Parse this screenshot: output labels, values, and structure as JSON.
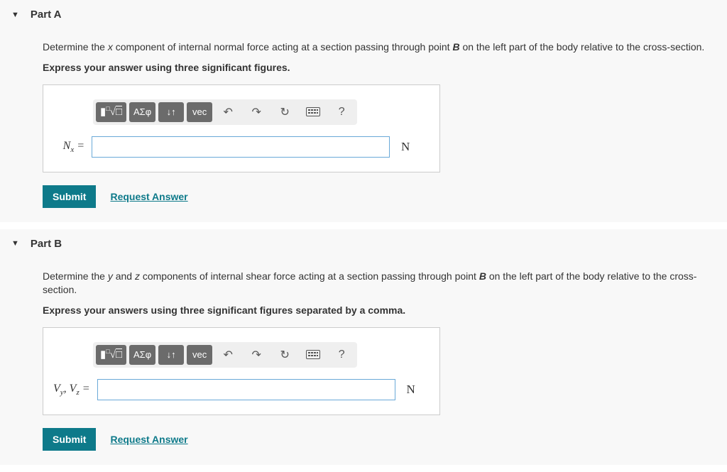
{
  "partA": {
    "title": "Part A",
    "prompt_pre": "Determine the ",
    "prompt_var1": "x",
    "prompt_mid": " component of internal normal force acting at a section passing through point ",
    "prompt_var2": "B",
    "prompt_post": " on the left part of the body relative to the cross-section.",
    "instruction": "Express your answer using three significant figures.",
    "toolbar": {
      "templates": "▮√□",
      "greek": "ΑΣφ",
      "subsuper": "↓↑",
      "vec": "vec",
      "undo": "↶",
      "redo": "↷",
      "reset": "↻",
      "help": "?"
    },
    "var_label_html": "N<sub class='sub'>x</sub> =",
    "var_label_text": "Nₓ =",
    "unit": "N",
    "value": "",
    "submit": "Submit",
    "request": "Request Answer"
  },
  "partB": {
    "title": "Part B",
    "prompt_pre": "Determine the ",
    "prompt_var1": "y",
    "prompt_mid1": " and ",
    "prompt_var2": "z",
    "prompt_mid2": " components of internal shear force acting at a section passing through point ",
    "prompt_var3": "B",
    "prompt_post": " on the left part of the body relative to the cross-section.",
    "instruction": "Express your answers using three significant figures separated by a comma.",
    "toolbar": {
      "templates": "▮√□",
      "greek": "ΑΣφ",
      "subsuper": "↓↑",
      "vec": "vec",
      "undo": "↶",
      "redo": "↷",
      "reset": "↻",
      "help": "?"
    },
    "var_label_text": "Vᵧ, V_z =",
    "unit": "N",
    "value": "",
    "submit": "Submit",
    "request": "Request Answer"
  }
}
